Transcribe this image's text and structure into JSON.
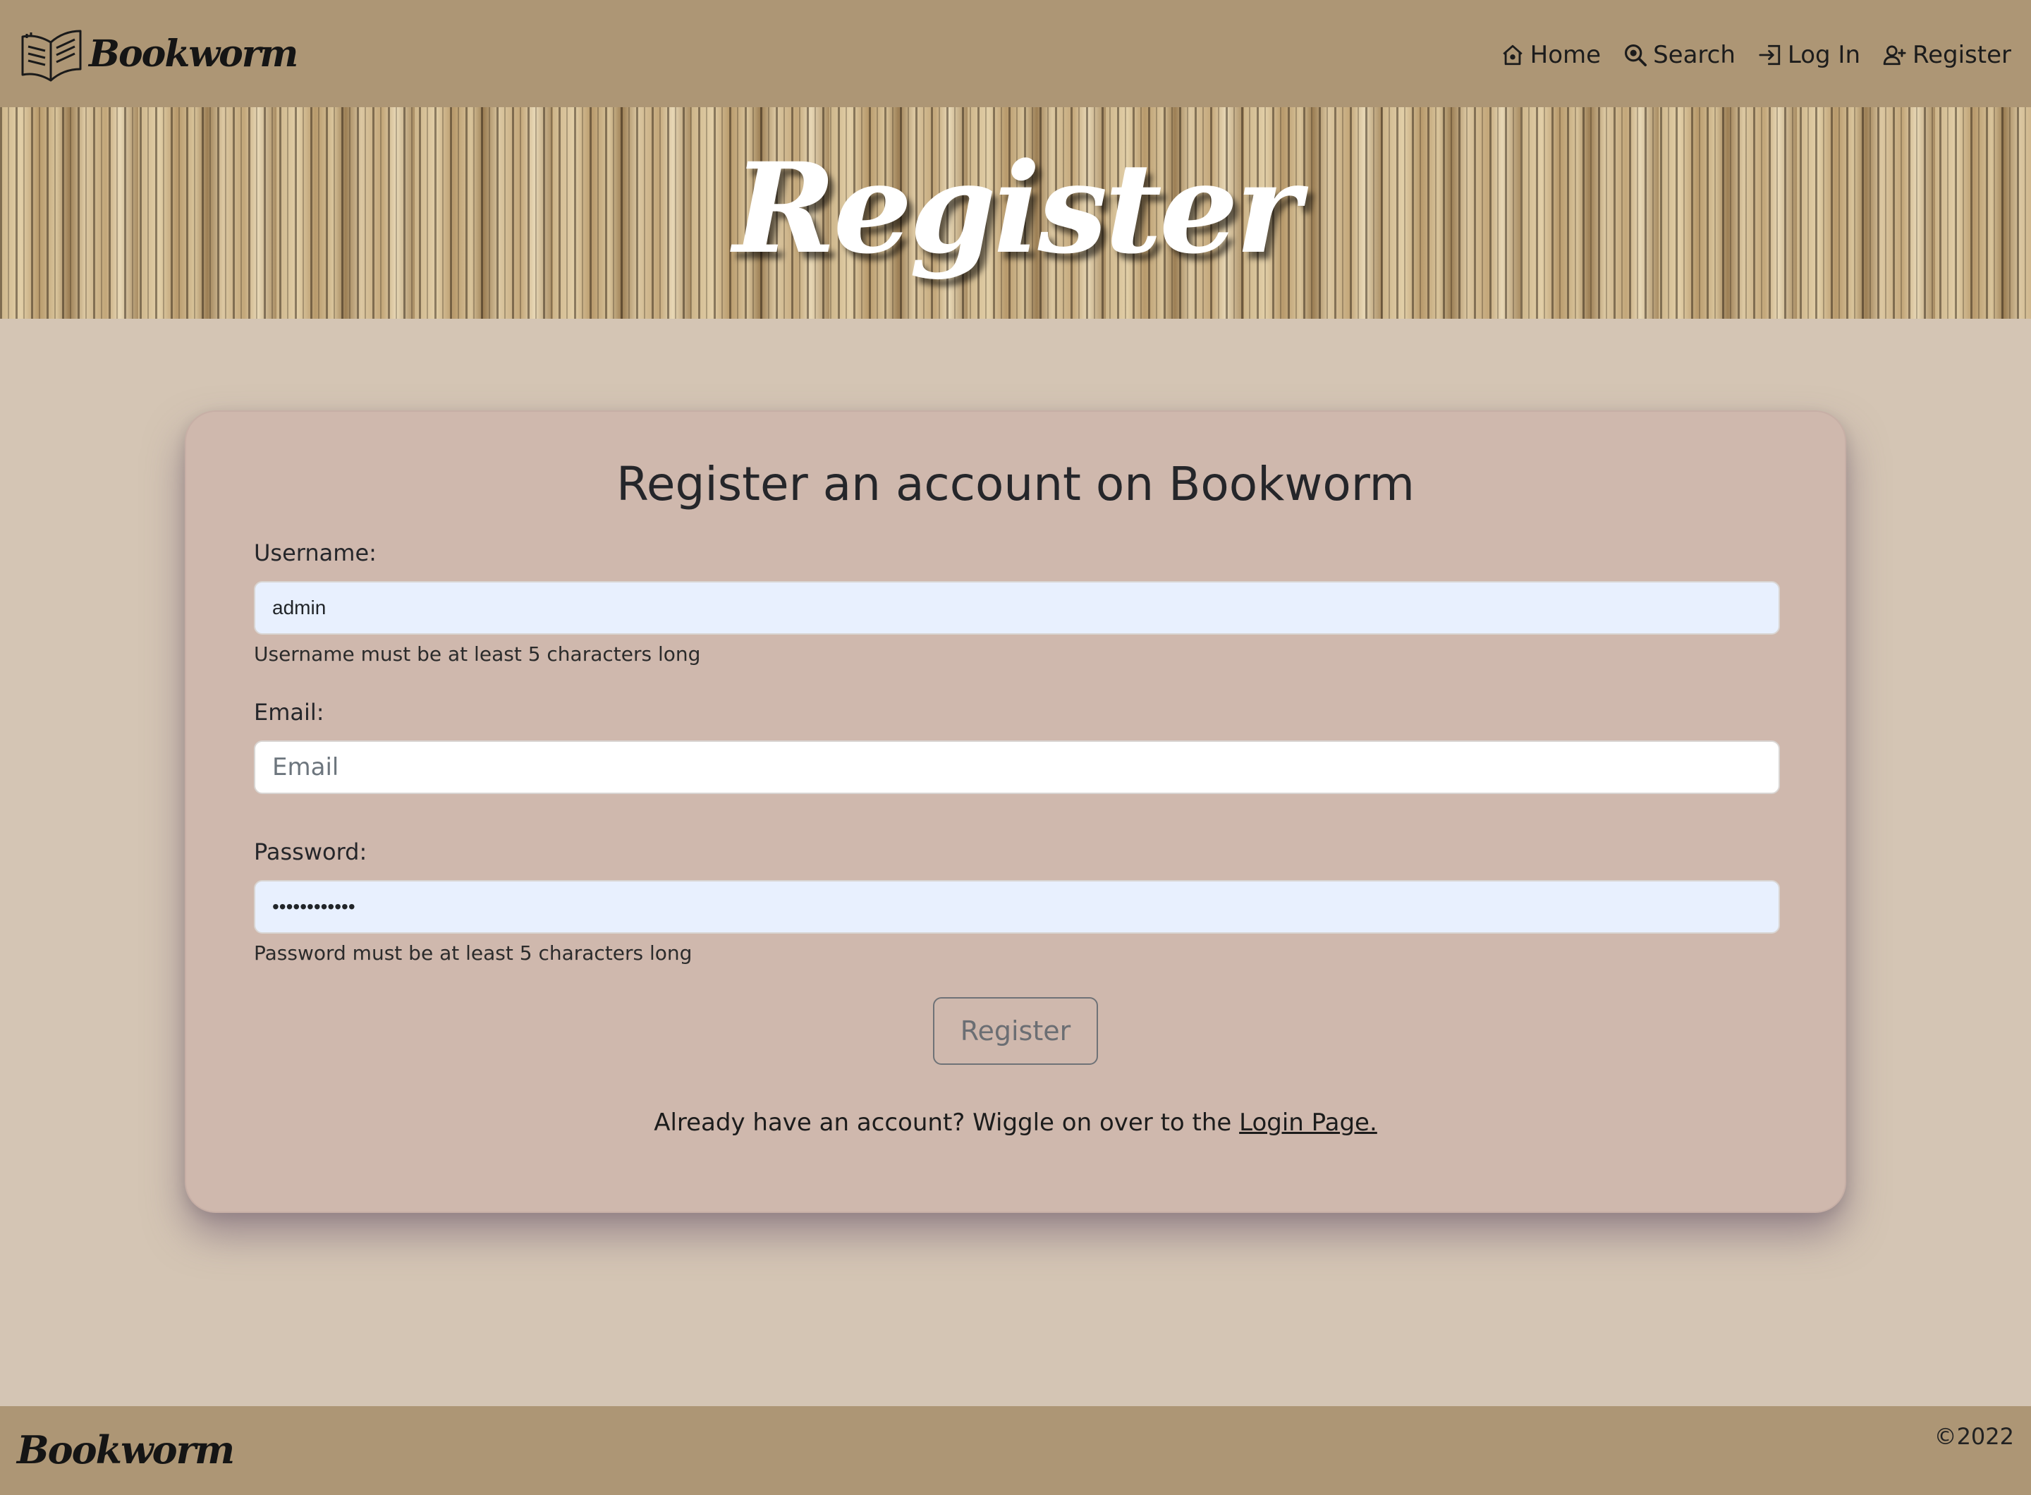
{
  "navbar": {
    "brand": "Bookworm",
    "links": [
      {
        "label": "Home",
        "icon": "home-icon"
      },
      {
        "label": "Search",
        "icon": "search-icon"
      },
      {
        "label": "Log In",
        "icon": "login-icon"
      },
      {
        "label": "Register",
        "icon": "add-user-icon"
      }
    ]
  },
  "banner": {
    "title": "Register"
  },
  "form": {
    "title": "Register an account on Bookworm",
    "username": {
      "label": "Username:",
      "value": "admin",
      "helper": "Username must be at least 5 characters long"
    },
    "email": {
      "label": "Email:",
      "value": "",
      "placeholder": "Email"
    },
    "password": {
      "label": "Password:",
      "value": "••••••••••••",
      "helper": "Password must be at least 5 characters long"
    },
    "submit_label": "Register",
    "login_prompt": "Already have an account? Wiggle on over to the",
    "login_link": "Login Page."
  },
  "footer": {
    "brand": "Bookworm",
    "copyright": "©2022"
  },
  "colors": {
    "navbar_bg": "#ad9675",
    "page_bg": "#d4c5b4",
    "card_bg": "#cfb8ad",
    "autofill_bg": "#e8f0fe"
  }
}
